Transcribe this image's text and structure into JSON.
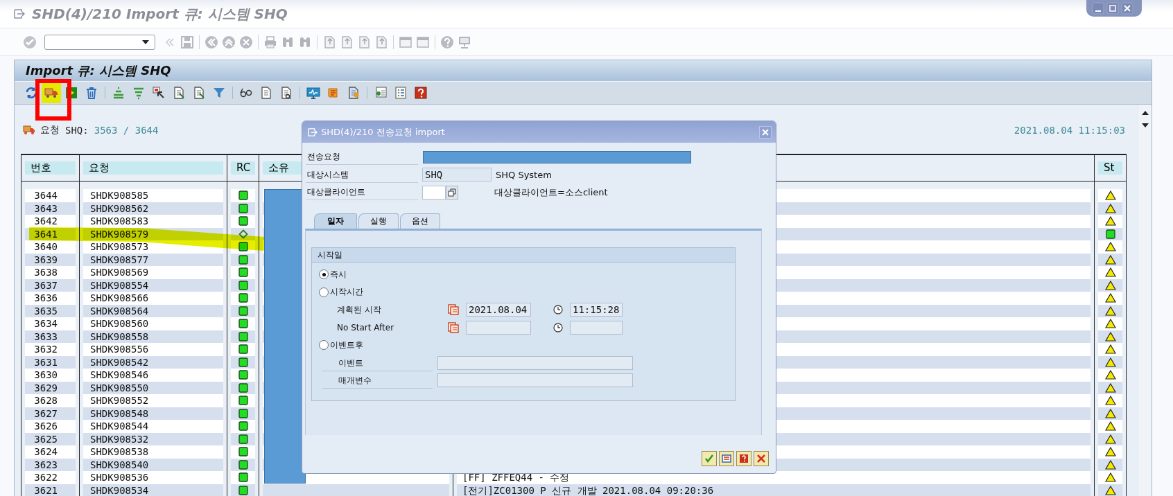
{
  "window": {
    "title": "SHD(4)/210 Import 큐: 시스템 SHQ"
  },
  "screen": {
    "title": "Import 큐: 시스템 SHQ"
  },
  "summary": {
    "label": "요청",
    "system": "SHQ:",
    "count": "3563 / 3644",
    "timestamp": "2021.08.04 11:15:03"
  },
  "table": {
    "columns": [
      "번호",
      "요청",
      "RC",
      "소유",
      "St"
    ],
    "rows": [
      {
        "number": "3644",
        "request": "SHDK908585",
        "rc": {
          "kind": "square"
        },
        "st": {
          "kind": "warning"
        }
      },
      {
        "number": "3643",
        "request": "SHDK908562",
        "rc": {
          "kind": "square"
        },
        "st": {
          "kind": "warning"
        }
      },
      {
        "number": "3642",
        "request": "SHDK908583",
        "rc": {
          "kind": "square"
        },
        "st": {
          "kind": "warning"
        }
      },
      {
        "number": "3641",
        "request": "SHDK908579",
        "rc": {
          "kind": "diamond"
        },
        "st": {
          "kind": "ok"
        }
      },
      {
        "number": "3640",
        "request": "SHDK908573",
        "rc": {
          "kind": "square"
        },
        "st": {
          "kind": "warning"
        }
      },
      {
        "number": "3639",
        "request": "SHDK908577",
        "rc": {
          "kind": "square"
        },
        "st": {
          "kind": "warning"
        }
      },
      {
        "number": "3638",
        "request": "SHDK908569",
        "rc": {
          "kind": "square"
        },
        "st": {
          "kind": "warning"
        }
      },
      {
        "number": "3637",
        "request": "SHDK908554",
        "rc": {
          "kind": "square"
        },
        "st": {
          "kind": "warning"
        }
      },
      {
        "number": "3636",
        "request": "SHDK908566",
        "rc": {
          "kind": "square"
        },
        "st": {
          "kind": "warning"
        }
      },
      {
        "number": "3635",
        "request": "SHDK908564",
        "rc": {
          "kind": "square"
        },
        "st": {
          "kind": "warning"
        }
      },
      {
        "number": "3634",
        "request": "SHDK908560",
        "rc": {
          "kind": "square"
        },
        "st": {
          "kind": "warning"
        }
      },
      {
        "number": "3633",
        "request": "SHDK908558",
        "rc": {
          "kind": "square"
        },
        "st": {
          "kind": "warning"
        }
      },
      {
        "number": "3632",
        "request": "SHDK908556",
        "rc": {
          "kind": "square"
        },
        "st": {
          "kind": "warning"
        }
      },
      {
        "number": "3631",
        "request": "SHDK908542",
        "rc": {
          "kind": "square"
        },
        "st": {
          "kind": "warning"
        }
      },
      {
        "number": "3630",
        "request": "SHDK908546",
        "rc": {
          "kind": "square"
        },
        "st": {
          "kind": "warning"
        }
      },
      {
        "number": "3629",
        "request": "SHDK908550",
        "rc": {
          "kind": "square"
        },
        "st": {
          "kind": "warning"
        }
      },
      {
        "number": "3628",
        "request": "SHDK908552",
        "rc": {
          "kind": "square"
        },
        "st": {
          "kind": "warning"
        }
      },
      {
        "number": "3627",
        "request": "SHDK908548",
        "rc": {
          "kind": "square"
        },
        "st": {
          "kind": "warning"
        }
      },
      {
        "number": "3626",
        "request": "SHDK908544",
        "rc": {
          "kind": "square"
        },
        "st": {
          "kind": "warning"
        }
      },
      {
        "number": "3625",
        "request": "SHDK908532",
        "rc": {
          "kind": "square"
        },
        "st": {
          "kind": "warning"
        }
      },
      {
        "number": "3624",
        "request": "SHDK908538",
        "rc": {
          "kind": "square"
        },
        "st": {
          "kind": "warning"
        }
      },
      {
        "number": "3623",
        "request": "SHDK908540",
        "rc": {
          "kind": "square"
        },
        "st": {
          "kind": "warning"
        }
      },
      {
        "number": "3622",
        "request": "SHDK908536",
        "rc": {
          "kind": "square"
        },
        "st": {
          "kind": "warning"
        },
        "description": "[FF] ZFFEQ44 - 수정"
      },
      {
        "number": "3621",
        "request": "SHDK908534",
        "rc": {
          "kind": "square"
        },
        "st": {
          "kind": "warning"
        },
        "description": "[전기]ZC01300 P 신규 개발 2021.08.04 09:20:36"
      }
    ]
  },
  "dialog": {
    "title": "SHD(4)/210 전송요청 import",
    "fields": [
      {
        "kind": "redacted",
        "label": "전송요청"
      },
      {
        "kind": "text",
        "label": "대상시스템",
        "value": "SHQ",
        "note": "SHQ System"
      },
      {
        "kind": "picker",
        "label": "대상클라이언트",
        "note": "대상클라이언트=소스client"
      }
    ],
    "tabs": [
      {
        "label": "일자",
        "selected": true
      },
      {
        "label": "실행",
        "selected": false
      },
      {
        "label": "옵션",
        "selected": false
      }
    ],
    "group": {
      "title": "시작일",
      "items": [
        {
          "kind": "radio",
          "label": "즉시",
          "selected": true
        },
        {
          "kind": "radio",
          "label": "시작시간",
          "selected": false
        },
        {
          "kind": "datetime",
          "label": "계획된 시작",
          "date": "2021.08.04",
          "time": "11:15:28"
        },
        {
          "kind": "datetime",
          "label": "No Start After"
        },
        {
          "kind": "radio",
          "label": "이벤트후",
          "selected": false
        },
        {
          "kind": "field",
          "label": "이벤트"
        },
        {
          "kind": "field",
          "label": "매개변수"
        }
      ]
    }
  }
}
